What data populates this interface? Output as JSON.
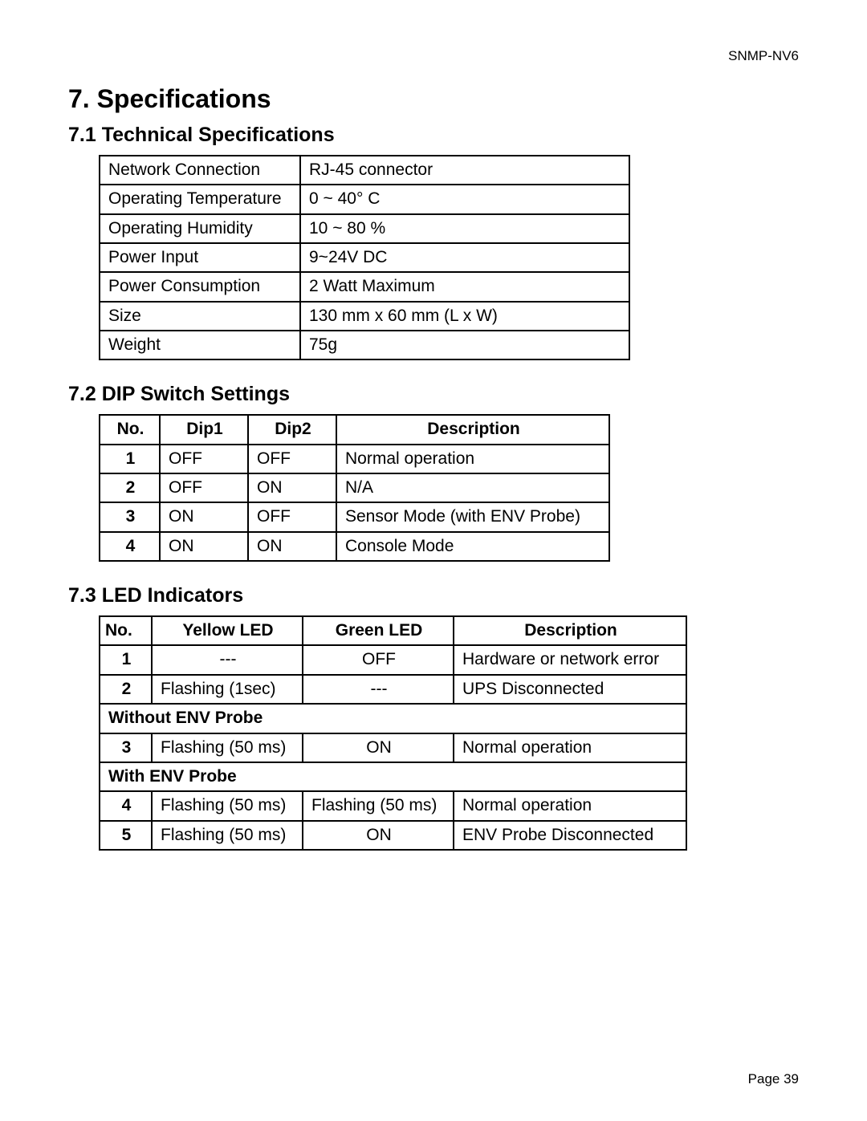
{
  "header": {
    "doc_id": "SNMP-NV6"
  },
  "title": "7. Specifications",
  "sections": {
    "tech": {
      "heading": "7.1 Technical Specifications",
      "rows": [
        {
          "label": "Network Connection",
          "value": "RJ-45 connector"
        },
        {
          "label": "Operating Temperature",
          "value": "0 ~ 40° C"
        },
        {
          "label": "Operating Humidity",
          "value": "10 ~ 80 %"
        },
        {
          "label": "Power Input",
          "value": "9~24V DC"
        },
        {
          "label": "Power Consumption",
          "value": "2 Watt Maximum"
        },
        {
          "label": "Size",
          "value": "130 mm x 60 mm (L x W)"
        },
        {
          "label": "Weight",
          "value": "75g"
        }
      ]
    },
    "dip": {
      "heading": "7.2 DIP Switch Settings",
      "headers": {
        "no": "No.",
        "d1": "Dip1",
        "d2": "Dip2",
        "desc": "Description"
      },
      "rows": [
        {
          "no": "1",
          "d1": "OFF",
          "d2": "OFF",
          "desc": "Normal operation"
        },
        {
          "no": "2",
          "d1": "OFF",
          "d2": "ON",
          "desc": "N/A"
        },
        {
          "no": "3",
          "d1": "ON",
          "d2": "OFF",
          "desc": "Sensor Mode (with ENV Probe)"
        },
        {
          "no": "4",
          "d1": "ON",
          "d2": "ON",
          "desc": "Console Mode"
        }
      ]
    },
    "led": {
      "heading": "7.3 LED Indicators",
      "headers": {
        "no": "No.",
        "yel": "Yellow LED",
        "grn": "Green LED",
        "desc": "Description"
      },
      "rows_top": [
        {
          "no": "1",
          "yel": "---",
          "grn": "OFF",
          "desc": "Hardware or network error",
          "yel_center": true
        },
        {
          "no": "2",
          "yel": "Flashing (1sec)",
          "grn": "---",
          "desc": "UPS Disconnected"
        }
      ],
      "section1": "Without ENV Probe",
      "rows_mid": [
        {
          "no": "3",
          "yel": "Flashing (50 ms)",
          "grn": "ON",
          "desc": "Normal operation"
        }
      ],
      "section2": "With ENV Probe",
      "rows_bot": [
        {
          "no": "4",
          "yel": "Flashing (50 ms)",
          "grn": "Flashing (50 ms)",
          "desc": "Normal operation"
        },
        {
          "no": "5",
          "yel": "Flashing (50 ms)",
          "grn": "ON",
          "desc": "ENV Probe Disconnected"
        }
      ]
    }
  },
  "footer": {
    "page": "Page 39"
  }
}
